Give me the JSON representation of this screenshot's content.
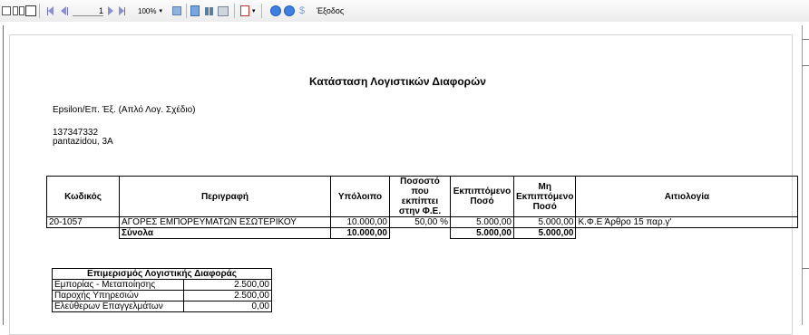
{
  "toolbar": {
    "page_number": "1",
    "zoom": "100%",
    "exit_label": "Έξοδος"
  },
  "report": {
    "title": "Κατάσταση Λογιστικών Διαφορών",
    "company": "Epsilon/Επ. Έξ. (Απλό Λογ. Σχέδιο)",
    "tax_id": "137347332",
    "address": "pantazidou, 3A"
  },
  "table": {
    "headers": {
      "code": "Κωδικός",
      "description": "Περιγραφή",
      "balance": "Υπόλοιπο",
      "percent": "Ποσοστό που εκπίπτει στην Φ.Ε.",
      "deductible": "Εκπιπτόμενο Ποσό",
      "non_deductible": "Μη Εκπιπτόμενο Ποσό",
      "justification": "Αιτιολογία"
    },
    "row": {
      "code": "20-1057",
      "description": "ΑΓΟΡΕΣ ΕΜΠΟΡΕΥΜΑΤΩΝ ΕΣΩΤΕΡΙΚΟΥ",
      "balance": "10.000,00",
      "percent": "50,00 %",
      "deductible": "5.000,00",
      "non_deductible": "5.000,00",
      "justification": "Κ.Φ.Ε Άρθρο 15 παρ.γ'"
    },
    "totals": {
      "label": "Σύνολα",
      "balance": "10.000,00",
      "deductible": "5.000,00",
      "non_deductible": "5.000,00"
    }
  },
  "allocation": {
    "title": "Επιμερισμός Λογιστικής Διαφοράς",
    "rows": [
      {
        "label": "Εμπορίας - Μεταποίησης",
        "value": "2.500,00"
      },
      {
        "label": "Παροχής Υπηρεσιών",
        "value": "2.500,00"
      },
      {
        "label": "Ελεύθερων Επαγγελμάτων",
        "value": "0,00"
      }
    ]
  }
}
